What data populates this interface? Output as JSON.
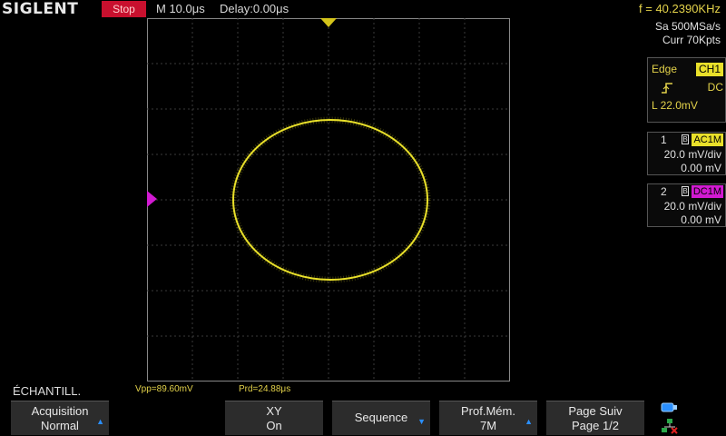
{
  "header": {
    "logo": "SIGLENT",
    "run_state": "Stop",
    "timebase": "M 10.0μs",
    "delay": "Delay:0.00μs",
    "frequency": "f = 40.2390KHz"
  },
  "acquisition_info": {
    "sample_rate": "Sa 500MSa/s",
    "memory": "Curr 70Kpts"
  },
  "trigger": {
    "mode": "Edge",
    "source": "CH1",
    "slope_icon": "rising-edge-icon",
    "coupling": "DC",
    "level": "L  22.0mV"
  },
  "channels": [
    {
      "number": "1",
      "bw_icon": "B",
      "coupling": "AC1M",
      "scale": "20.0 mV/div",
      "offset": "0.00 mV",
      "color": "#e9e02a"
    },
    {
      "number": "2",
      "bw_icon": "B",
      "coupling": "DC1M",
      "scale": "20.0 mV/div",
      "offset": "0.00 mV",
      "color": "#d21ad2"
    }
  ],
  "display": {
    "mode_label": "ÉCHANTILL.",
    "trace_color": "#e9e02a",
    "ch2_marker_color": "#d21ad2",
    "trigger_marker_color": "#d4c41a"
  },
  "measurements": {
    "vpp": "Vpp=89.60mV",
    "prd": "Prd=24.88μs"
  },
  "softkeys": [
    {
      "line1": "Acquisition",
      "line2": "Normal",
      "arrow": true
    },
    {
      "line1": "XY",
      "line2": "On",
      "arrow": false
    },
    {
      "line1": "Sequence",
      "line2": "",
      "arrow": true
    },
    {
      "line1": "Prof.Mém.",
      "line2": "7M",
      "arrow": true
    },
    {
      "line1": "Page Suiv",
      "line2": "Page 1/2",
      "arrow": false
    }
  ],
  "status_icons": [
    "usb-icon",
    "network-icon"
  ]
}
